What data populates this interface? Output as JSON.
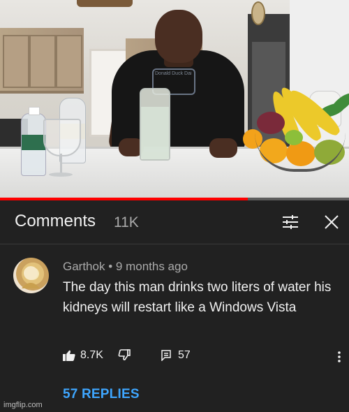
{
  "video": {
    "progress_fraction": 0.71,
    "shirt_text": "Donald Duck Dai"
  },
  "comments_panel": {
    "title": "Comments",
    "count": "11K",
    "icons": {
      "filter": "filter-sliders-icon",
      "close": "close-icon"
    }
  },
  "comment": {
    "author": "Garthok",
    "separator": "•",
    "time": "9 months ago",
    "text": "The day this man drinks two liters of water his kidneys will restart like a Windows Vista",
    "likes": "8.7K",
    "reply_count": "57",
    "replies_label": "57 REPLIES",
    "icons": {
      "like": "thumbs-up-icon",
      "dislike": "thumbs-down-icon",
      "reply": "reply-icon",
      "more": "more-vertical-icon"
    }
  },
  "watermark": "imgflip.com",
  "colors": {
    "background": "#212121",
    "link": "#3ea6ff",
    "progress": "#ff0000",
    "secondary_text": "#aaaaaa",
    "primary_text": "#f1f1f1"
  }
}
